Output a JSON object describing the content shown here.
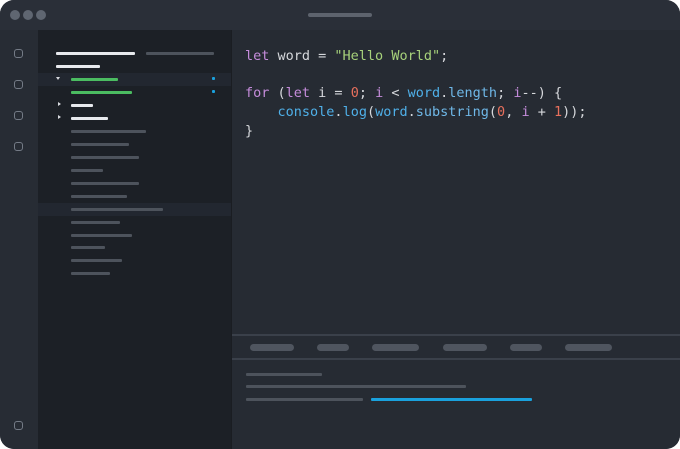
{
  "titlebar": {
    "window_controls": [
      "window-dot-close",
      "window-dot-minimize",
      "window-dot-zoom"
    ]
  },
  "activity_bar": {
    "icons": [
      "explorer-icon",
      "search-icon",
      "source-control-icon",
      "extensions-icon",
      "settings-icon"
    ]
  },
  "sidebar": {
    "modified_marker_color": "#1aa1dd",
    "added_color": "#4bbc61"
  },
  "editor": {
    "lines": [
      [
        {
          "t": "let",
          "c": "kw"
        },
        {
          "t": " word = ",
          "c": "plain"
        },
        {
          "t": "\"Hello World\"",
          "c": "str"
        },
        {
          "t": ";",
          "c": "plain"
        }
      ],
      [],
      [
        {
          "t": "for",
          "c": "kw"
        },
        {
          "t": " (",
          "c": "plain"
        },
        {
          "t": "let",
          "c": "kw"
        },
        {
          "t": " i = ",
          "c": "plain"
        },
        {
          "t": "0",
          "c": "num"
        },
        {
          "t": "; ",
          "c": "plain"
        },
        {
          "t": "i",
          "c": "kw"
        },
        {
          "t": " < ",
          "c": "plain"
        },
        {
          "t": "word",
          "c": "fn"
        },
        {
          "t": ".",
          "c": "plain"
        },
        {
          "t": "length",
          "c": "prop"
        },
        {
          "t": "; ",
          "c": "plain"
        },
        {
          "t": "i",
          "c": "kw"
        },
        {
          "t": "--) {",
          "c": "plain"
        }
      ],
      [
        {
          "t": "    ",
          "c": "plain"
        },
        {
          "t": "console",
          "c": "fn"
        },
        {
          "t": ".",
          "c": "plain"
        },
        {
          "t": "log",
          "c": "fn"
        },
        {
          "t": "(",
          "c": "plain"
        },
        {
          "t": "word",
          "c": "fn"
        },
        {
          "t": ".",
          "c": "plain"
        },
        {
          "t": "substring",
          "c": "prop"
        },
        {
          "t": "(",
          "c": "plain"
        },
        {
          "t": "0",
          "c": "num"
        },
        {
          "t": ", ",
          "c": "plain"
        },
        {
          "t": "i",
          "c": "kw"
        },
        {
          "t": " + ",
          "c": "plain"
        },
        {
          "t": "1",
          "c": "num"
        },
        {
          "t": "));",
          "c": "plain"
        }
      ],
      [
        {
          "t": "}",
          "c": "plain"
        }
      ]
    ]
  },
  "panel": {
    "progress_color": "#1aa1dd"
  }
}
